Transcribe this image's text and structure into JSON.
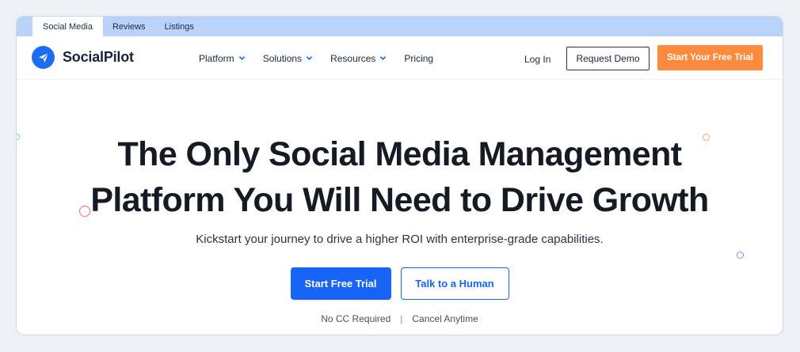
{
  "tabs": [
    {
      "label": "Social Media",
      "active": true
    },
    {
      "label": "Reviews",
      "active": false
    },
    {
      "label": "Listings",
      "active": false
    }
  ],
  "brand": {
    "name": "SocialPilot",
    "color": "#1b6ef3",
    "icon": "paper-plane-icon"
  },
  "nav": {
    "items": [
      {
        "label": "Platform",
        "dropdown": true
      },
      {
        "label": "Solutions",
        "dropdown": true
      },
      {
        "label": "Resources",
        "dropdown": true
      },
      {
        "label": "Pricing",
        "dropdown": false
      }
    ],
    "login": "Log In",
    "demo": "Request Demo",
    "trial": "Start Your Free Trial"
  },
  "hero": {
    "headline_line1": "The Only Social Media Management",
    "headline_line2": "Platform You Will Need to Drive Growth",
    "subtext": "Kickstart your journey to drive a higher ROI with enterprise-grade capabilities.",
    "primary_cta": "Start Free Trial",
    "secondary_cta": "Talk to a Human",
    "note1": "No CC Required",
    "separator": "|",
    "note2": "Cancel Anytime"
  },
  "colors": {
    "accent": "#1764f6",
    "orange": "#ff8a3d",
    "tabbar": "#b9d3fa"
  }
}
